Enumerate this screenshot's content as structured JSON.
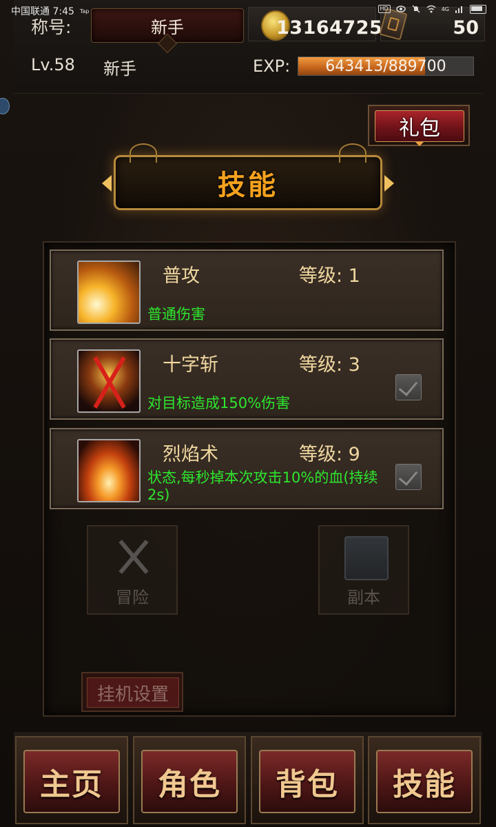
{
  "status_bar": {
    "carrier": "中国联通 7:45",
    "tap_label": "Tap",
    "hd": "HD",
    "signal_label": "4G"
  },
  "header": {
    "title_label": "称号:",
    "title_value": "新手",
    "gold": "13164725",
    "gems": "50",
    "level": "Lv.58",
    "rank": "新手",
    "exp_label": "EXP:",
    "exp_text": "643413/889700",
    "exp_fraction": 0.723
  },
  "gift_button": {
    "label": "礼包"
  },
  "banner": {
    "title": "技能"
  },
  "skills": [
    {
      "name": "普攻",
      "level": "等级: 1",
      "desc": "普通伤害",
      "checkbox": false
    },
    {
      "name": "十字斩",
      "level": "等级: 3",
      "desc": "对目标造成150%伤害",
      "checkbox": true
    },
    {
      "name": "烈焰术",
      "level": "等级: 9",
      "desc": "状态,每秒掉本次攻击10%的血(持续2s)",
      "checkbox": true
    }
  ],
  "ghost_buttons": {
    "adventure": "冒险",
    "dungeon": "副本",
    "afk_settings": "挂机设置"
  },
  "bottom_nav": {
    "home": "主页",
    "character": "角色",
    "bag": "背包",
    "skills": "技能"
  }
}
